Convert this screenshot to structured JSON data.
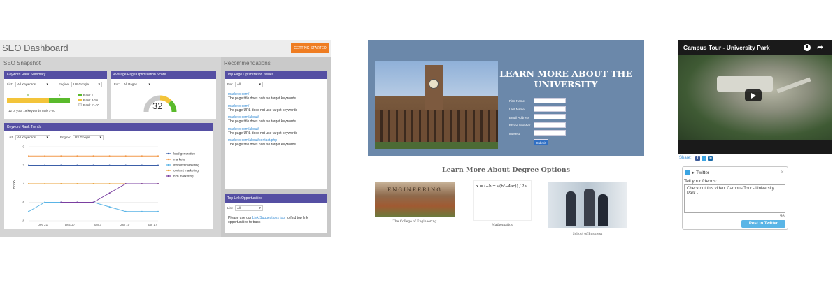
{
  "seo": {
    "title": "SEO Dashboard",
    "cta_label": "GETTING STARTED",
    "snapshot_label": "SEO Snapshot",
    "recommendations_label": "Recommendations",
    "rank_summary": {
      "title": "Keyword Rank Summary",
      "list_label": "List:",
      "list_value": "All Keywords",
      "engine_label": "Engine:",
      "engine_value": "US Google",
      "bar_numbers": [
        "8",
        "4"
      ],
      "legend": [
        "Rank 1",
        "Rank 2-10",
        "Rank 11-20"
      ],
      "note": "12 of your 19 keywords rank 1-20"
    },
    "optimization_score": {
      "title": "Average Page Optimization Score",
      "for_label": "For:",
      "for_value": "All Pages",
      "score": "32"
    },
    "rank_trends": {
      "title": "Keyword Rank Trends",
      "list_label": "List:",
      "list_value": "All Keywords",
      "engine_label": "Engine:",
      "engine_value": "US Google",
      "y_label": "RANK",
      "y_ticks": [
        "0",
        "2",
        "4",
        "6",
        "8"
      ],
      "x_ticks": [
        "Dec 21",
        "Dec 27",
        "Jan 3",
        "Jan 10",
        "Jan 17"
      ],
      "legend": [
        "lead generation",
        "marketo",
        "inbound marketing",
        "content marketing",
        "b2b marketing"
      ]
    },
    "top_page_issues": {
      "title": "Top Page Optimization Issues",
      "for_label": "For:",
      "for_value": "All",
      "items": [
        {
          "url": "marketo.com/",
          "issue": "The page title does not use target keywords"
        },
        {
          "url": "marketo.com/",
          "issue": "The page URL does not use target keywords"
        },
        {
          "url": "marketo.com/about/",
          "issue": "The page title does not use target keywords"
        },
        {
          "url": "marketo.com/about/",
          "issue": "The page URL does not use target keywords"
        },
        {
          "url": "marketo.com/about/contact.php",
          "issue": "The page title does not use target keywords"
        }
      ]
    },
    "top_link": {
      "title": "Top Link Opportunities",
      "list_label": "List:",
      "list_value": "All",
      "text_before": "Please use our",
      "link_text": "Link Suggestions tool",
      "text_after": "to find top link opportunities to track"
    }
  },
  "chart_data": {
    "type": "line",
    "x": [
      "Dec 21",
      "Dec 24",
      "Dec 27",
      "Dec 31",
      "Jan 3",
      "Jan 7",
      "Jan 10",
      "Jan 14",
      "Jan 17"
    ],
    "ylabel": "RANK",
    "ylim": [
      0,
      8
    ],
    "y_inverted": true,
    "legend_position": "right",
    "series": [
      {
        "name": "lead generation",
        "color": "#3b5fa8",
        "values": [
          2,
          2,
          2,
          2,
          2,
          2,
          2,
          2,
          2
        ]
      },
      {
        "name": "marketo",
        "color": "#f2994a",
        "values": [
          1,
          1,
          1,
          1,
          1,
          1,
          1,
          1,
          1
        ]
      },
      {
        "name": "inbound marketing",
        "color": "#5ab4e6",
        "values": [
          7,
          6,
          6,
          6,
          6,
          6.5,
          7,
          7,
          7
        ]
      },
      {
        "name": "content marketing",
        "color": "#e8a13a",
        "values": [
          4,
          4,
          4,
          4,
          4,
          4,
          4,
          4,
          4
        ]
      },
      {
        "name": "b2b marketing",
        "color": "#7a3fa0",
        "values": [
          null,
          null,
          6,
          6,
          6,
          5,
          4,
          4,
          4
        ]
      }
    ]
  },
  "university": {
    "heading": "LEARN MORE ABOUT THE UNIVERSITY",
    "fields": [
      "First Name",
      "Last Name",
      "Email Address",
      "Phone Number",
      "Interest"
    ],
    "submit_label": "Submit",
    "degree_title": "Learn More About Degree Options",
    "degrees": [
      {
        "caption": "The College of Engineering",
        "image_text": "ENGINEERING"
      },
      {
        "caption": "Mathematics",
        "image_text": "x = (−b ± √(b²−4ac)) / 2a"
      },
      {
        "caption": "School of Business",
        "image_text": ""
      }
    ]
  },
  "video": {
    "title": "Campus Tour - University Park",
    "share_label": "Share:",
    "twitter": {
      "title": "Twitter",
      "prompt": "Tell your friends:",
      "message": "Check out this video: Campus Tour - University Park -",
      "char_count": "56",
      "post_label": "Post to Twitter"
    }
  },
  "colors": {
    "header_purple": "#554fa3",
    "cta_orange": "#ef7d22",
    "banner_blue": "#6b88aa",
    "twitter_blue": "#5ab5e6"
  }
}
